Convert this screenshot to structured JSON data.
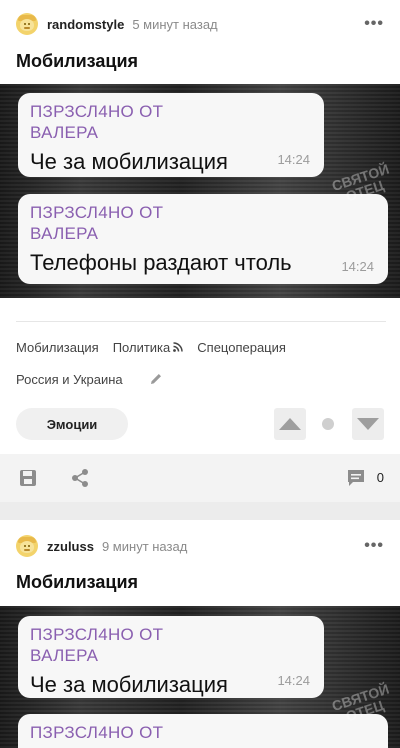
{
  "posts": [
    {
      "author": "randomstyle",
      "time": "5 минут назад",
      "title": "Мобилизация",
      "image": {
        "bubbles": [
          {
            "forwarded": "ПЗРЗСЛ4НО ОТ\nВАЛЕРА",
            "text": "Че за мобилизация",
            "time": "14:24"
          },
          {
            "forwarded": "ПЗРЗСЛ4НО ОТ\nВАЛЕРА",
            "text": "Телефоны раздают чтоль",
            "time": "14:24"
          }
        ],
        "watermark": "СВЯТОЙ\nОТЕЦ"
      },
      "tags": [
        "Мобилизация",
        "Политика",
        "Спецоперация",
        "Россия и Украина"
      ],
      "emotion_label": "Эмоции",
      "comment_count": "0"
    },
    {
      "author": "zzuluss",
      "time": "9 минут назад",
      "title": "Мобилизация",
      "image": {
        "bubbles": [
          {
            "forwarded": "ПЗРЗСЛ4НО ОТ\nВАЛЕРА",
            "text": "Че за мобилизация",
            "time": "14:24"
          },
          {
            "forwarded": "ПЗРЗСЛ4НО ОТ",
            "text": "",
            "time": ""
          }
        ],
        "watermark": "СВЯТОЙ\nОТЕЦ"
      }
    }
  ],
  "icons": {
    "more": "more-icon",
    "rss": "rss-icon",
    "edit": "pencil-icon",
    "upvote": "arrow-up-icon",
    "downvote": "arrow-down-icon",
    "save": "save-icon",
    "share": "share-icon",
    "comment": "comment-icon"
  },
  "colors": {
    "accent_forward": "#8a5fb0",
    "action_bar": "#f3f3f3"
  }
}
